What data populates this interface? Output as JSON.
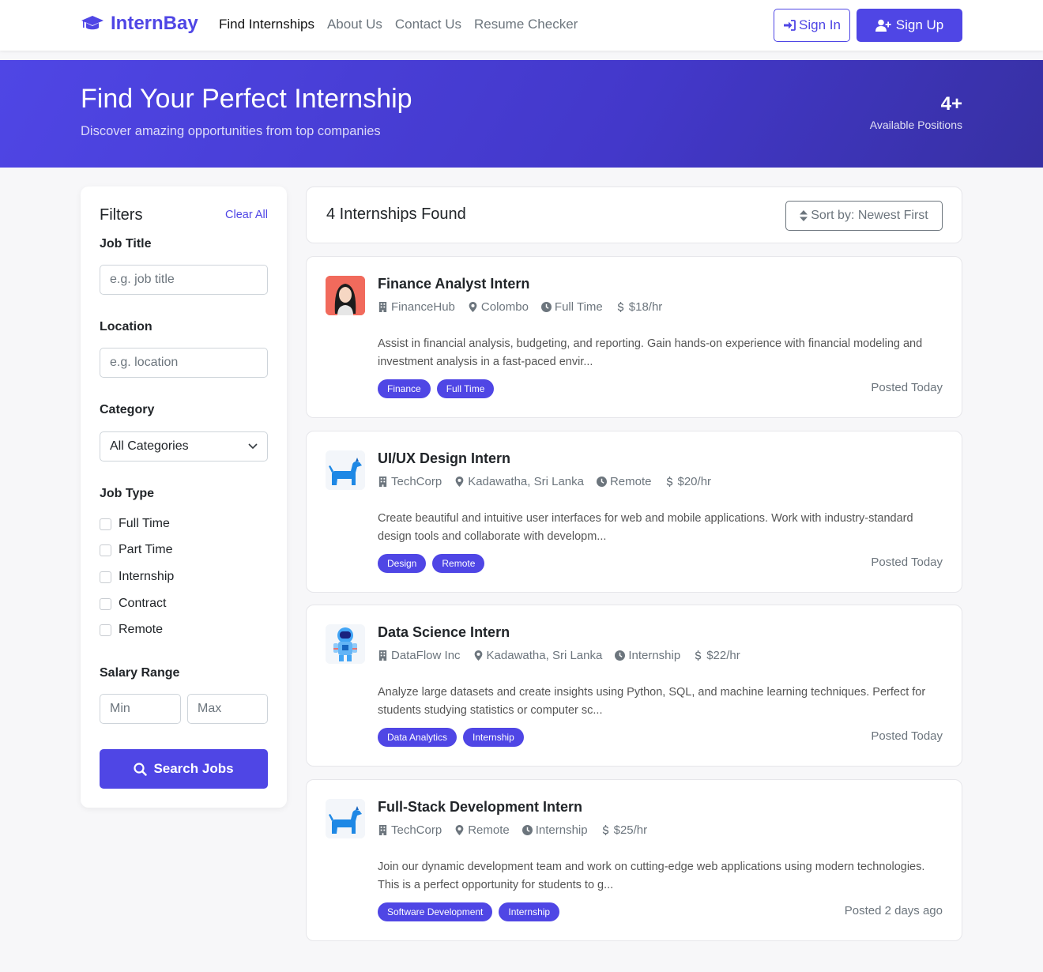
{
  "nav": {
    "brand": "InternBay",
    "links": [
      "Find Internships",
      "About Us",
      "Contact Us",
      "Resume Checker"
    ],
    "sign_in": "Sign In",
    "sign_up": "Sign Up"
  },
  "hero": {
    "title": "Find Your Perfect Internship",
    "subtitle": "Discover amazing opportunities from top companies",
    "stat_value": "4+",
    "stat_label": "Available Positions"
  },
  "filters": {
    "heading": "Filters",
    "clear_all": "Clear All",
    "job_title_label": "Job Title",
    "job_title_placeholder": "e.g. job title",
    "location_label": "Location",
    "location_placeholder": "e.g. location",
    "category_label": "Category",
    "category_value": "All Categories",
    "job_type_label": "Job Type",
    "job_types": [
      "Full Time",
      "Part Time",
      "Internship",
      "Contract",
      "Remote"
    ],
    "salary_label": "Salary Range",
    "salary_min_placeholder": "Min",
    "salary_max_placeholder": "Max",
    "search_button": "Search Jobs"
  },
  "results": {
    "count_text": "4 Internships Found",
    "sort_label": "Sort by: Newest First"
  },
  "jobs": [
    {
      "title": "Finance Analyst Intern",
      "company": "FinanceHub",
      "location": "Colombo",
      "type": "Full Time",
      "pay": "$18/hr",
      "description": "Assist in financial analysis, budgeting, and reporting. Gain hands-on experience with financial modeling and investment analysis in a fast-paced envir...",
      "tags": [
        "Finance",
        "Full Time"
      ],
      "posted": "Posted Today",
      "logo": "woman-avatar"
    },
    {
      "title": "UI/UX Design Intern",
      "company": "TechCorp",
      "location": "Kadawatha, Sri Lanka",
      "type": "Remote",
      "pay": "$20/hr",
      "description": "Create beautiful and intuitive user interfaces for web and mobile applications. Work with industry-standard design tools and collaborate with developm...",
      "tags": [
        "Design",
        "Remote"
      ],
      "posted": "Posted Today",
      "logo": "dog"
    },
    {
      "title": "Data Science Intern",
      "company": "DataFlow Inc",
      "location": "Kadawatha, Sri Lanka",
      "type": "Internship",
      "pay": "$22/hr",
      "description": "Analyze large datasets and create insights using Python, SQL, and machine learning techniques. Perfect for students studying statistics or computer sc...",
      "tags": [
        "Data Analytics",
        "Internship"
      ],
      "posted": "Posted Today",
      "logo": "astronaut"
    },
    {
      "title": "Full-Stack Development Intern",
      "company": "TechCorp",
      "location": "Remote",
      "type": "Internship",
      "pay": "$25/hr",
      "description": "Join our dynamic development team and work on cutting-edge web applications using modern technologies. This is a perfect opportunity for students to g...",
      "tags": [
        "Software Development",
        "Internship"
      ],
      "posted": "Posted 2 days ago",
      "logo": "dog"
    }
  ],
  "colors": {
    "accent": "#4f46e5",
    "hero_end": "#3730a3",
    "muted_text": "#6c757d"
  }
}
